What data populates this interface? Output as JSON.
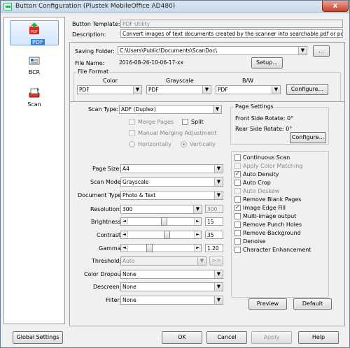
{
  "window": {
    "title": "Button Configuration (Plustek MobileOffice AD480)",
    "close_label": "x"
  },
  "sidebar": {
    "items": [
      {
        "label": "PDF",
        "icon": "pdf-icon",
        "selected": true
      },
      {
        "label": "BCR",
        "icon": "bcr-card-icon",
        "selected": false
      },
      {
        "label": "Scan",
        "icon": "scanner-icon",
        "selected": false
      }
    ],
    "pdf_badge": "PDF"
  },
  "header": {
    "template_label": "Button Template:",
    "template_value": "PDF Utility",
    "description_label": "Description:",
    "description_value": "Convert images of text documents created by the scanner into searchable pdf or pdf image"
  },
  "saving": {
    "folder_label": "Saving Folder:",
    "folder_value": "C:\\Users\\Public\\Documents\\ScanDoc\\",
    "browse_label": "...",
    "filename_label": "File Name:",
    "filename_value": "2016-08-26-10-06-17-xx",
    "setup_label": "Setup...",
    "fileformat_label": "File Format",
    "color_label": "Color",
    "grayscale_label": "Grayscale",
    "bw_label": "B/W",
    "color_value": "PDF",
    "grayscale_value": "PDF",
    "bw_value": "PDF",
    "configure_label": "Configure..."
  },
  "scan": {
    "scantype_label": "Scan Type:",
    "scantype_value": "ADF (Duplex)",
    "merge_pages_label": "Merge Pages",
    "split_label": "Split",
    "manual_merge_label": "Manual Merging Adjustment",
    "horizontally_label": "Horizontally",
    "vertically_label": "Vertically",
    "pagesize_label": "Page Size:",
    "pagesize_value": "A4",
    "scanmode_label": "Scan Mode:",
    "scanmode_value": "Grayscale",
    "doctype_label": "Document Type:",
    "doctype_value": "Photo & Text",
    "resolution_label": "Resolution:",
    "resolution_value": "300",
    "resolution_custom": "300",
    "brightness_label": "Brightness:",
    "brightness_value": "15",
    "brightness_level": 0.55,
    "contrast_label": "Contrast:",
    "contrast_value": "35",
    "contrast_level": 0.6,
    "gamma_label": "Gamma:",
    "gamma_value": "1.20",
    "gamma_level": 0.3,
    "threshold_label": "Threshold:",
    "threshold_value": "Auto",
    "threshold_btn": ">>",
    "colordropout_label": "Color Dropout:",
    "colordropout_value": "None",
    "descreen_label": "Descreen:",
    "descreen_value": "None",
    "filter_label": "Filter:",
    "filter_value": "None"
  },
  "page_settings": {
    "title": "Page Settings",
    "front_rotate": "Front Side Rotate: 0°",
    "rear_rotate": "Rear Side Rotate: 0°",
    "configure_label": "Configure..."
  },
  "options": [
    {
      "label": "Continuous Scan",
      "checked": false,
      "enabled": true
    },
    {
      "label": "Apply Color Matching",
      "checked": false,
      "enabled": false
    },
    {
      "label": "Auto Density",
      "checked": true,
      "enabled": true
    },
    {
      "label": "Auto Crop",
      "checked": false,
      "enabled": true
    },
    {
      "label": "Auto Deskew",
      "checked": false,
      "enabled": false
    },
    {
      "label": "Remove Blank Pages",
      "checked": false,
      "enabled": true
    },
    {
      "label": "Image Edge Fill",
      "checked": true,
      "enabled": true
    },
    {
      "label": "Multi-image output",
      "checked": false,
      "enabled": true
    },
    {
      "label": "Remove Punch Holes",
      "checked": false,
      "enabled": true
    },
    {
      "label": "Remove Background",
      "checked": false,
      "enabled": true
    },
    {
      "label": "Denoise",
      "checked": false,
      "enabled": true
    },
    {
      "label": "Character Enhancement",
      "checked": false,
      "enabled": true
    }
  ],
  "preview_label": "Preview",
  "default_label": "Default",
  "footer": {
    "global_label": "Global Settings",
    "ok_label": "OK",
    "cancel_label": "Cancel",
    "apply_label": "Apply",
    "help_label": "Help"
  }
}
